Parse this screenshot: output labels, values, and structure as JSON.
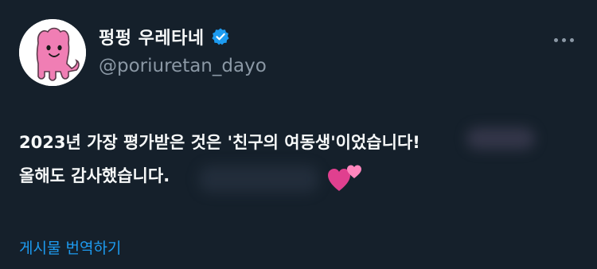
{
  "author": {
    "display_name": "펑펑 우레타네",
    "handle": "@poriuretan_dayo",
    "verified": true,
    "avatar_icon": "pink-creature-avatar"
  },
  "tweet": {
    "lines": [
      "2023년 가장 평가받은 것은 '친구의 여동생'이었습니다!",
      "올해도 감사했습니다."
    ],
    "emoji": "two-hearts-icon"
  },
  "actions": {
    "translate_label": "게시물 번역하기",
    "more_icon": "more-options-icon"
  },
  "colors": {
    "background": "#15202b",
    "text": "#f7f9f9",
    "secondary_text": "#8b98a5",
    "link": "#1d9bf0",
    "verified_badge": "#1d9bf0",
    "avatar_pink": "#f07eb4"
  }
}
